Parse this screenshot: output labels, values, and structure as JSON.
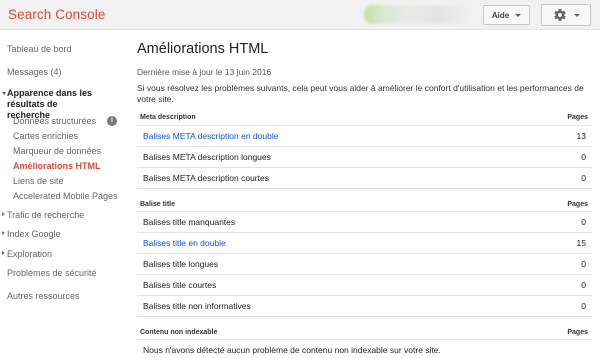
{
  "header": {
    "brand": "Search Console",
    "help_label": "Aide",
    "settings_icon": "gear-icon",
    "brand_color": "#dd4b39"
  },
  "sidebar": {
    "items": [
      {
        "label": "Tableau de bord"
      },
      {
        "label": "Messages (4)"
      },
      {
        "label": "Apparence dans les résultats de recherche"
      },
      {
        "label": "Données structurées"
      },
      {
        "label": "Cartes enrichies"
      },
      {
        "label": "Marqueur de données"
      },
      {
        "label": "Améliorations HTML"
      },
      {
        "label": "Liens de site"
      },
      {
        "label": "Accelerated Mobile Pages"
      },
      {
        "label": "Trafic de recherche"
      },
      {
        "label": "Index Google"
      },
      {
        "label": "Exploration"
      },
      {
        "label": "Problèmes de sécurité"
      },
      {
        "label": "Autres ressources"
      }
    ],
    "info_icon_glyph": "i"
  },
  "main": {
    "title": "Améliorations HTML",
    "updated": "Dernière mise à jour le 13 juin 2016",
    "description": "Si vous résolvez les problèmes suivants, cela peut vous aider à améliorer le confort d'utilisation et les performances de votre site.",
    "sections": [
      {
        "header": "Meta description",
        "pages_header": "Pages",
        "rows": [
          {
            "label": "Balises META description en double",
            "count": "13",
            "link": true
          },
          {
            "label": "Balises META description longues",
            "count": "0",
            "link": false
          },
          {
            "label": "Balises META description courtes",
            "count": "0",
            "link": false
          }
        ]
      },
      {
        "header": "Balise title",
        "pages_header": "Pages",
        "rows": [
          {
            "label": "Balises title manquantes",
            "count": "0",
            "link": false
          },
          {
            "label": "Balises title en double",
            "count": "15",
            "link": true
          },
          {
            "label": "Balises title longues",
            "count": "0",
            "link": false
          },
          {
            "label": "Balises title courtes",
            "count": "0",
            "link": false
          },
          {
            "label": "Balises title non informatives",
            "count": "0",
            "link": false
          }
        ]
      },
      {
        "header": "Contenu non indexable",
        "pages_header": "Pages",
        "message": "Nous n'avons détecté aucun problème de contenu non indexable sur votre site."
      }
    ],
    "link_color": "#1155cc"
  }
}
